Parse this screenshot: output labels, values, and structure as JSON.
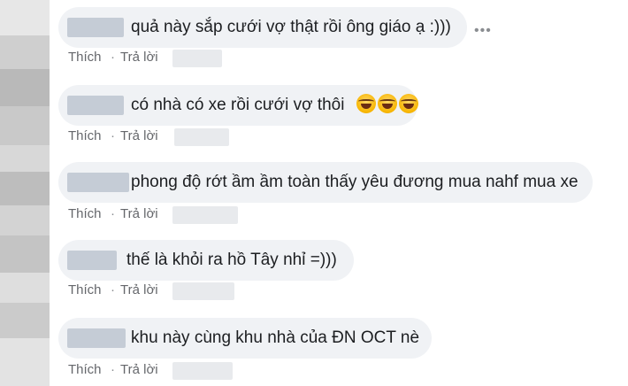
{
  "more_icon": "more-horizontal-icon",
  "comments": [
    {
      "text": "quả này sắp cưới vợ thật rồi ông giáo ạ :)))",
      "like": "Thích",
      "reply": "Trả lời"
    },
    {
      "text": "có nhà có xe rồi cưới vợ thôi",
      "emojis": [
        "laughing-tears-emoji",
        "laughing-tears-emoji",
        "laughing-tears-emoji"
      ],
      "like": "Thích",
      "reply": "Trả lời"
    },
    {
      "text": "phong độ rớt ầm ầm toàn thấy yêu đương mua nahf mua xe",
      "like": "Thích",
      "reply": "Trả lời"
    },
    {
      "text": "thế là khỏi ra hồ Tây nhỉ =)))",
      "like": "Thích",
      "reply": "Trả lời"
    },
    {
      "text": "khu này cùng khu nhà của ĐN OCT nè",
      "like": "Thích",
      "reply": "Trả lời"
    }
  ]
}
